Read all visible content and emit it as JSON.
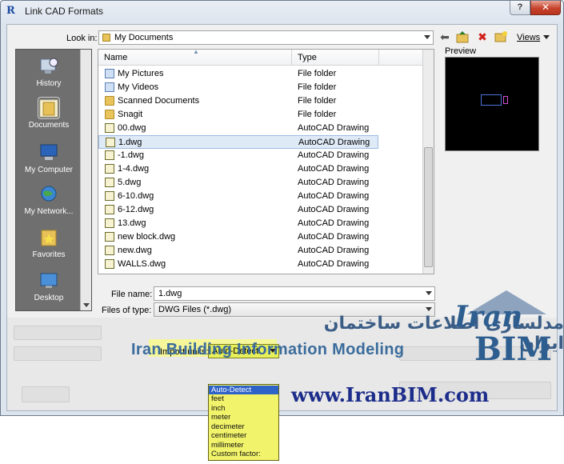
{
  "window": {
    "title": "Link CAD Formats",
    "app_icon": "R",
    "help_label": "?",
    "close_label": "✕"
  },
  "toolbar": {
    "look_in_label": "Look in:",
    "look_in_value": "My Documents",
    "views_label": "Views",
    "icons": [
      "back-arrow-icon",
      "up-folder-icon",
      "delete-icon",
      "new-folder-icon"
    ]
  },
  "places": [
    {
      "label": "History",
      "icon": "history-icon",
      "selected": false
    },
    {
      "label": "Documents",
      "icon": "documents-folder-icon",
      "selected": true
    },
    {
      "label": "My Computer",
      "icon": "my-computer-icon",
      "selected": false
    },
    {
      "label": "My Network...",
      "icon": "network-globe-icon",
      "selected": false
    },
    {
      "label": "Favorites",
      "icon": "favorites-folder-icon",
      "selected": false
    },
    {
      "label": "Desktop",
      "icon": "desktop-icon",
      "selected": false
    }
  ],
  "file_list": {
    "columns": [
      "Name",
      "Type"
    ],
    "rows": [
      {
        "name": "My Pictures",
        "type": "File folder",
        "icon": "media-folder"
      },
      {
        "name": "My Videos",
        "type": "File folder",
        "icon": "media-folder"
      },
      {
        "name": "Scanned Documents",
        "type": "File folder",
        "icon": "folder"
      },
      {
        "name": "Snagit",
        "type": "File folder",
        "icon": "folder"
      },
      {
        "name": "00.dwg",
        "type": "AutoCAD Drawing",
        "icon": "dwg"
      },
      {
        "name": "1.dwg",
        "type": "AutoCAD Drawing",
        "icon": "dwg",
        "selected": true
      },
      {
        "name": "-1.dwg",
        "type": "AutoCAD Drawing",
        "icon": "dwg"
      },
      {
        "name": "1-4.dwg",
        "type": "AutoCAD Drawing",
        "icon": "dwg"
      },
      {
        "name": "5.dwg",
        "type": "AutoCAD Drawing",
        "icon": "dwg"
      },
      {
        "name": "6-10.dwg",
        "type": "AutoCAD Drawing",
        "icon": "dwg"
      },
      {
        "name": "6-12.dwg",
        "type": "AutoCAD Drawing",
        "icon": "dwg"
      },
      {
        "name": "13.dwg",
        "type": "AutoCAD Drawing",
        "icon": "dwg"
      },
      {
        "name": "new block.dwg",
        "type": "AutoCAD Drawing",
        "icon": "dwg"
      },
      {
        "name": "new.dwg",
        "type": "AutoCAD Drawing",
        "icon": "dwg"
      },
      {
        "name": "WALLS.dwg",
        "type": "AutoCAD Drawing",
        "icon": "dwg"
      }
    ]
  },
  "preview": {
    "label": "Preview"
  },
  "file_name": {
    "label": "File name:",
    "value": "1.dwg"
  },
  "file_type": {
    "label": "Files of type:",
    "value": "DWG Files  (*.dwg)"
  },
  "import_units": {
    "label": "Import units:",
    "value": "Auto-Detect",
    "options": [
      "Auto-Detect",
      "feet",
      "inch",
      "meter",
      "decimeter",
      "centimeter",
      "millimeter",
      "Custom factor:"
    ],
    "highlighted": "Auto-Detect"
  },
  "watermark": {
    "persian": "مدلسازی اطلاعات ساختمان ایران",
    "english": "Iran Building Information Modeling",
    "url": "www.IranBIM.com",
    "logo_top": "Iran",
    "logo_bottom": "BIM"
  }
}
